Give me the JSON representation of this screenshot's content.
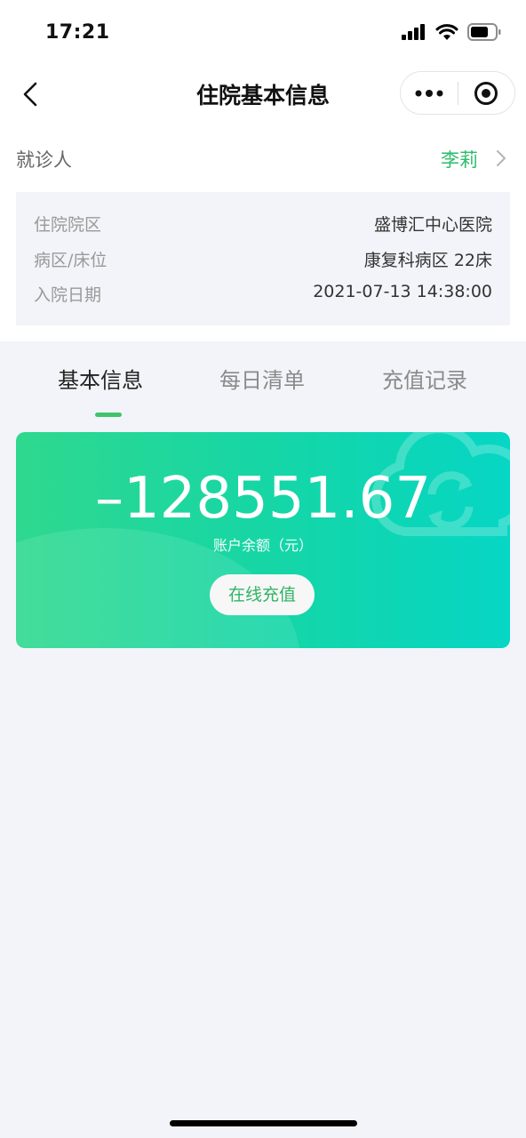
{
  "status_bar": {
    "time": "17:21"
  },
  "nav": {
    "title": "住院基本信息"
  },
  "patient": {
    "label": "就诊人",
    "name": "李莉"
  },
  "admission": {
    "rows": [
      {
        "label": "住院院区",
        "value": "盛博汇中心医院"
      },
      {
        "label": "病区/床位",
        "value": "康复科病区 22床"
      },
      {
        "label": "入院日期",
        "value": "2021-07-13 14:38:00"
      }
    ]
  },
  "tabs": [
    {
      "label": "基本信息",
      "active": true
    },
    {
      "label": "每日清单",
      "active": false
    },
    {
      "label": "充值记录",
      "active": false
    }
  ],
  "account": {
    "balance": "–128551.67",
    "balance_label": "账户余额（元）",
    "topup_label": "在线充值"
  },
  "colors": {
    "accent": "#2dbb6c",
    "card_start": "#2fd88e",
    "card_end": "#06d6c4",
    "page_bg": "#f3f4f9"
  },
  "icons": [
    "signal-icon",
    "wifi-icon",
    "battery-icon",
    "back-arrow-icon",
    "more-icon",
    "target-icon",
    "chevron-right-icon",
    "cloud-refresh-icon"
  ]
}
